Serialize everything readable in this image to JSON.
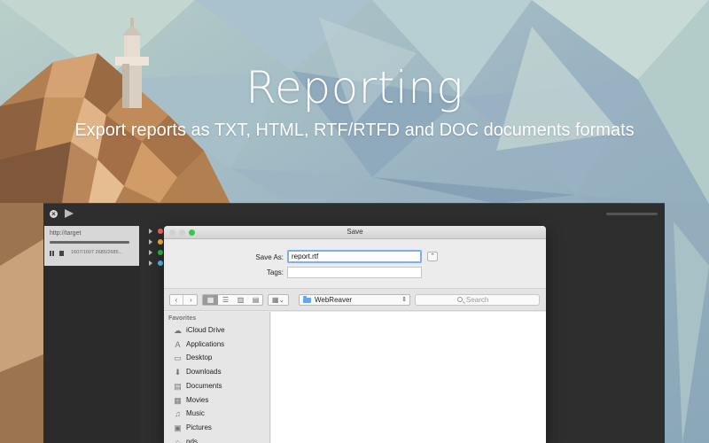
{
  "hero": {
    "title": "Reporting",
    "subtitle": "Export reports as TXT, HTML, RTF/RTFD and DOC documents formats"
  },
  "app": {
    "toolbar": {
      "close_icon": "close-icon",
      "play_icon": "play-icon"
    },
    "target": {
      "url": "http://target",
      "progress": 1.0,
      "stats": "1607/1607 2685/2685..."
    },
    "mini_rows": [
      {
        "color": "#ff5f57"
      },
      {
        "color": "#febc2e"
      },
      {
        "color": "#28c840"
      },
      {
        "color": "#4fc3f7"
      }
    ]
  },
  "dialog": {
    "title": "Save",
    "traffic_colors": [
      "#d0d0d0",
      "#d0d0d0",
      "#34c84a"
    ],
    "save_as_label": "Save As:",
    "filename": "report.rtf",
    "tags_label": "Tags:",
    "tags_value": "",
    "expand_glyph": "⌃",
    "nav": {
      "back": "‹",
      "forward": "›"
    },
    "view_glyphs": [
      "▦",
      "☰",
      "▥",
      "▤"
    ],
    "arrange_glyph": "▦⌄",
    "location": "WebReaver",
    "location_arrows": "⇕",
    "search_placeholder": "Search",
    "favorites_heading": "Favorites",
    "favorites": [
      {
        "label": "iCloud Drive",
        "icon": "☁"
      },
      {
        "label": "Applications",
        "icon": "A"
      },
      {
        "label": "Desktop",
        "icon": "▭"
      },
      {
        "label": "Downloads",
        "icon": "⬇"
      },
      {
        "label": "Documents",
        "icon": "▤"
      },
      {
        "label": "Movies",
        "icon": "▦"
      },
      {
        "label": "Music",
        "icon": "♫"
      },
      {
        "label": "Pictures",
        "icon": "▣"
      },
      {
        "label": "pds",
        "icon": "⌂"
      }
    ]
  }
}
